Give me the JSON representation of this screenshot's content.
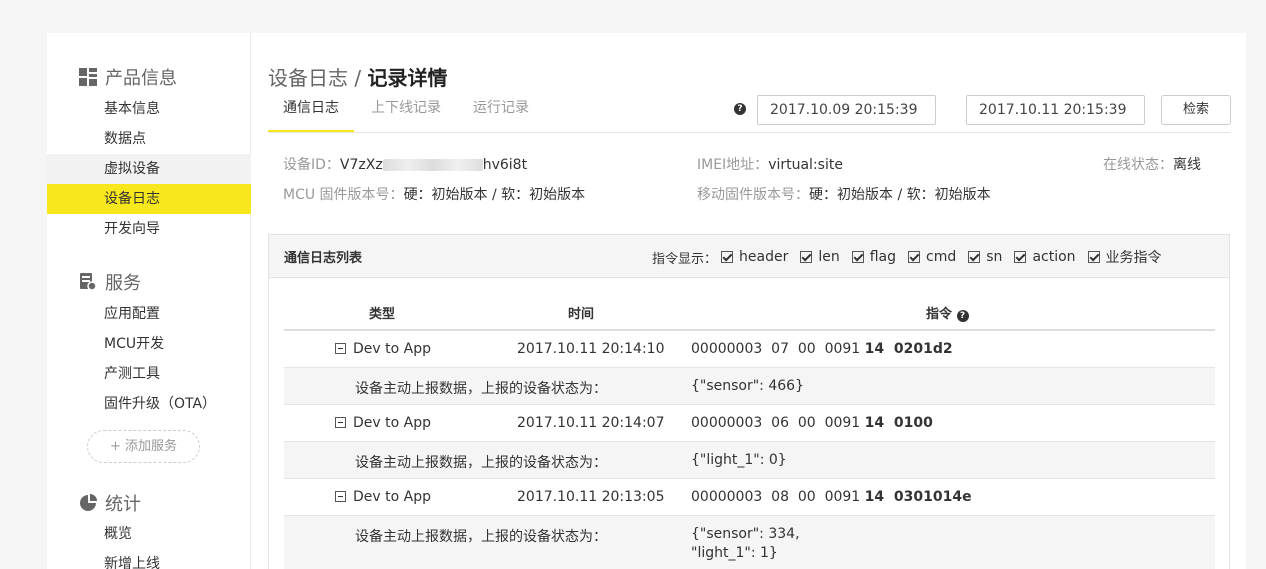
{
  "sidebar": {
    "product_title": "产品信息",
    "product_items": [
      "基本信息",
      "数据点",
      "虚拟设备",
      "设备日志",
      "开发向导"
    ],
    "service_title": "服务",
    "service_items": [
      "应用配置",
      "MCU开发",
      "产测工具",
      "固件升级（OTA）"
    ],
    "add_service": "+ 添加服务",
    "stats_title": "统计",
    "stats_items": [
      "概览",
      "新增上线"
    ],
    "accent_color": "#f8e71c"
  },
  "header": {
    "breadcrumb_parent": "设备日志",
    "breadcrumb_sep": " / ",
    "breadcrumb_current": "记录详情",
    "tabs": [
      "通信日志",
      "上下线记录",
      "运行记录"
    ],
    "start_time": "2017.10.09 20:15:39",
    "end_time": "2017.10.11 20:15:39",
    "search_label": "检索"
  },
  "device": {
    "id_label": "设备ID：",
    "id_prefix": "V7zXz",
    "id_suffix": "hv6i8t",
    "imei_label": "IMEI地址：",
    "imei_value": "virtual:site",
    "status_label": "在线状态：",
    "status_value": "离线",
    "mcu_label": "MCU 固件版本号：",
    "mcu_value": "硬：初始版本 / 软：初始版本",
    "mobile_label": "移动固件版本号：",
    "mobile_value": "硬：初始版本 / 软：初始版本"
  },
  "log_panel": {
    "title": "通信日志列表",
    "filter_label": "指令显示：",
    "filters": [
      "header",
      "len",
      "flag",
      "cmd",
      "sn",
      "action",
      "业务指令"
    ],
    "columns": [
      "类型",
      "时间",
      "指令"
    ],
    "rows": [
      {
        "type": "Dev to App",
        "time": "2017.10.11 20:14:10",
        "cmd_plain": "00000003  07  00  0091",
        "cmd_bold": "14  0201d2",
        "desc": "设备主动上报数据，上报的设备状态为：",
        "payload": [
          "{\"sensor\": 466}"
        ]
      },
      {
        "type": "Dev to App",
        "time": "2017.10.11 20:14:07",
        "cmd_plain": "00000003  06  00  0091",
        "cmd_bold": "14  0100",
        "desc": "设备主动上报数据，上报的设备状态为：",
        "payload": [
          "{\"light_1\": 0}"
        ]
      },
      {
        "type": "Dev to App",
        "time": "2017.10.11 20:13:05",
        "cmd_plain": "00000003  08  00  0091",
        "cmd_bold": "14  0301014e",
        "desc": "设备主动上报数据，上报的设备状态为：",
        "payload": [
          "{\"sensor\": 334,",
          "\"light_1\": 1}"
        ]
      }
    ]
  }
}
